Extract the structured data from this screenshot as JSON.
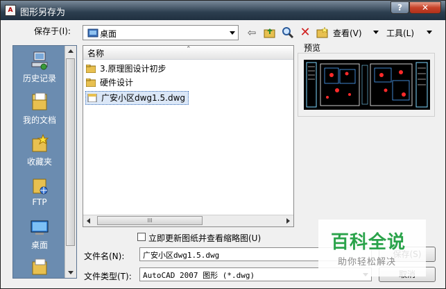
{
  "window": {
    "title": "图形另存为"
  },
  "titlebar": {
    "icon_text": "A",
    "help": "?",
    "close": "✕"
  },
  "toolbar": {
    "save_in_label": "保存于(I):",
    "save_in_value": "桌面",
    "view_label": "查看(V)",
    "tools_label": "工具(L)"
  },
  "places": [
    {
      "label": "历史记录",
      "icon": "history-icon"
    },
    {
      "label": "我的文档",
      "icon": "my-documents-icon"
    },
    {
      "label": "收藏夹",
      "icon": "favorites-icon"
    },
    {
      "label": "FTP",
      "icon": "ftp-icon"
    },
    {
      "label": "桌面",
      "icon": "desktop-icon"
    }
  ],
  "filelist": {
    "column_name": "名称",
    "items": [
      {
        "name": "3.原理图设计初步",
        "type": "folder"
      },
      {
        "name": "硬件设计",
        "type": "folder"
      },
      {
        "name": "广安小区dwg1.5.dwg",
        "type": "dwg",
        "selected": true
      }
    ],
    "hscroll_grip": "III"
  },
  "preview": {
    "label": "预览"
  },
  "options": {
    "update_thumbnail_label": "立即更新图纸并查看缩略图(U)",
    "update_thumbnail_checked": false
  },
  "filename": {
    "label": "文件名(N):",
    "value": "广安小区dwg1.5.dwg"
  },
  "filetype": {
    "label": "文件类型(T):",
    "value": "AutoCAD 2007 图形 (*.dwg)"
  },
  "buttons": {
    "save": "保存(S)",
    "cancel": "取消"
  },
  "watermark": {
    "title": "百科全说",
    "subtitle": "助你轻松解决"
  },
  "colors": {
    "title_bar": "#2c3e4f",
    "places_bg": "#6b8cb0",
    "close_button": "#c7432a",
    "watermark_green": "#2aa34a"
  }
}
